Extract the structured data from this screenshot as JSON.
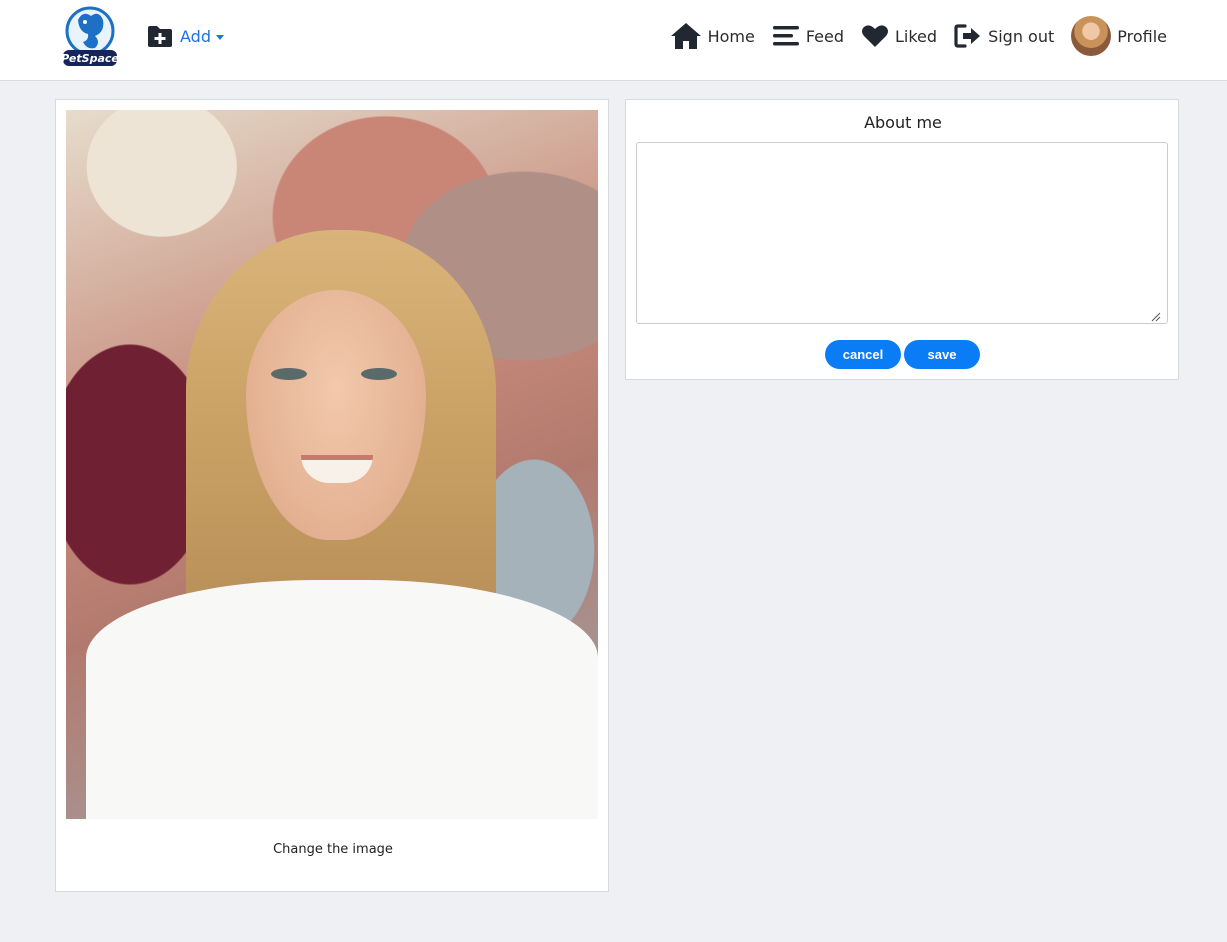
{
  "navbar": {
    "logo_text": "PetSpace",
    "add_label": "Add",
    "items": [
      {
        "label": "Home",
        "icon": "home-icon"
      },
      {
        "label": "Feed",
        "icon": "menu-icon"
      },
      {
        "label": "Liked",
        "icon": "heart-icon"
      },
      {
        "label": "Sign out",
        "icon": "sign-out-icon"
      },
      {
        "label": "Profile",
        "icon": "avatar"
      }
    ]
  },
  "profile": {
    "change_image_label": "Change the image"
  },
  "about": {
    "title": "About me",
    "value": "",
    "cancel_label": "cancel",
    "save_label": "save"
  },
  "colors": {
    "accent": "#0a7cf5",
    "link": "#1a73e8",
    "background": "#eef0f4",
    "navbar": "#ffffff"
  }
}
